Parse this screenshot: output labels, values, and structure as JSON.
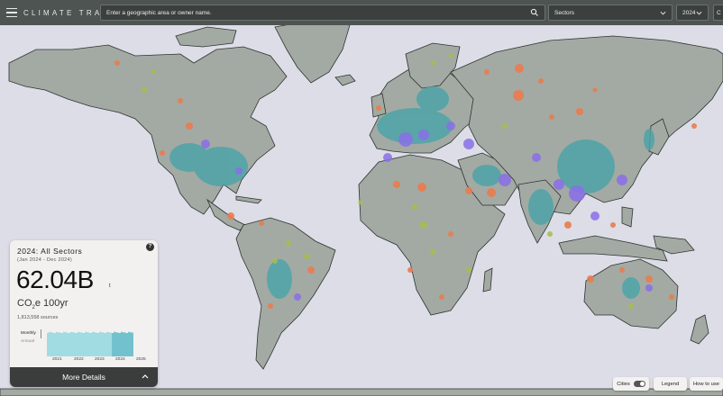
{
  "header": {
    "brand": "CLIMATE TRACE",
    "search_placeholder": "Enter a geographic area or owner name.",
    "sectors_label": "Sectors",
    "year_label": "2024",
    "extra_label": "C"
  },
  "panel": {
    "title": "2024: All Sectors",
    "date_range": "(Jan 2024 - Dec 2024)",
    "total_value": "62.04B",
    "unit": "t",
    "gas_prefix": "CO",
    "gas_sub": "2",
    "gas_suffix": "e 100yr",
    "sources_count": "1,813,558 sources",
    "toggle_monthly": "Monthly",
    "toggle_annual": "Annual",
    "years": [
      "2021",
      "2022",
      "2023",
      "2024",
      "2025"
    ],
    "more_details": "More Details"
  },
  "controls": {
    "cities_label": "Cities",
    "legend_label": "Legend",
    "how_to_label": "How to use"
  },
  "colors": {
    "topbar": "#4d5451",
    "land": "#a3aaa3",
    "ocean": "#dcdde6",
    "emitter_orange": "#ea7c4f",
    "emitter_purple": "#8a6fe8",
    "emitter_teal": "#4ea4a8",
    "emitter_green": "#a8bd48",
    "chart_bar": "#8cd6de",
    "chart_highlight": "#52b7c5"
  }
}
